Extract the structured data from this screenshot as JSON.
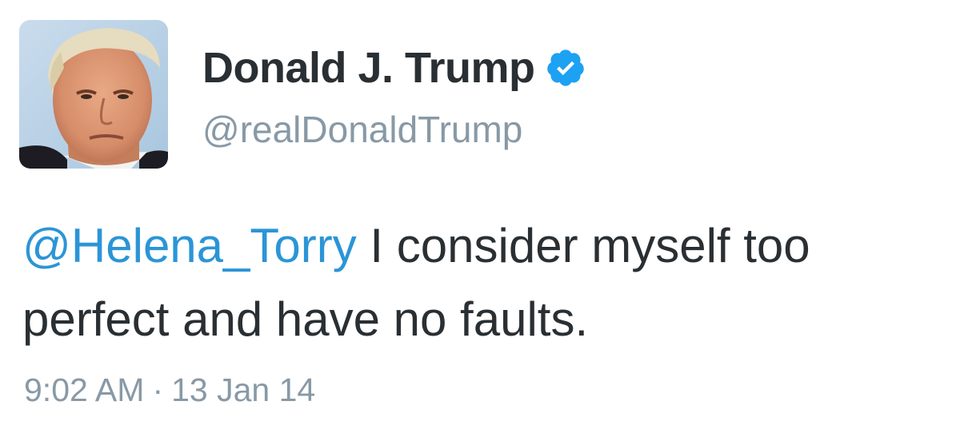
{
  "author": {
    "display_name": "Donald J. Trump",
    "handle": "@realDonaldTrump",
    "verified": true,
    "verified_icon": "verified-badge-icon",
    "avatar_icon": "profile-photo"
  },
  "tweet": {
    "mention": "@Helena_Torry",
    "text": " I consider myself too perfect and have no faults.",
    "time": "9:02 AM",
    "separator": "·",
    "date": "13 Jan 14"
  },
  "colors": {
    "text": "#292f33",
    "muted": "#8899a6",
    "link": "#2b95d6",
    "verified": "#1da1f2"
  }
}
